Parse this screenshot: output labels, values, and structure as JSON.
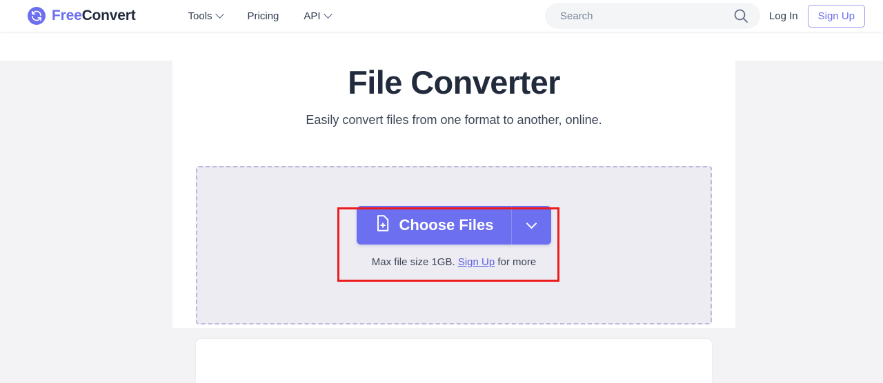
{
  "header": {
    "brand": {
      "first": "Free",
      "second": "Convert",
      "icon": "sync-circle-icon"
    },
    "nav": [
      {
        "label": "Tools",
        "has_caret": true
      },
      {
        "label": "Pricing",
        "has_caret": false
      },
      {
        "label": "API",
        "has_caret": true
      }
    ],
    "search": {
      "placeholder": "Search",
      "value": "",
      "icon": "search-icon"
    },
    "login_label": "Log In",
    "signup_label": "Sign Up"
  },
  "hero": {
    "title": "File Converter",
    "subtitle": "Easily convert files from one format to another, online."
  },
  "dropzone": {
    "choose_files_label": "Choose Files",
    "file_icon": "file-plus-icon",
    "caret_icon": "chevron-down-icon",
    "max_size_prefix": "Max file size 1GB.",
    "max_size_link": "Sign Up",
    "max_size_suffix": "for more"
  },
  "colors": {
    "accent": "#6c6ff0",
    "text_dark": "#222b3c",
    "dropzone_bg": "#edecf3",
    "dropzone_border": "#b9b9dd",
    "page_gutter": "#f3f3f5",
    "annotation": "#ec1c1c"
  }
}
